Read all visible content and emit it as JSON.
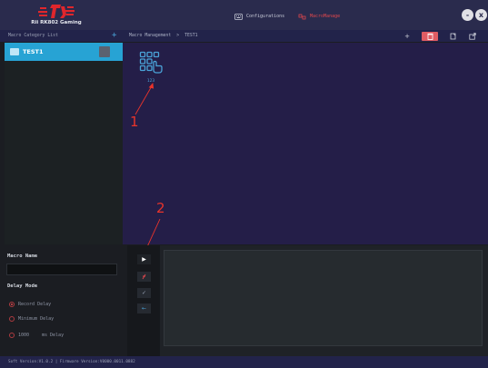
{
  "app": {
    "brand": "Rii RK802 Gaming",
    "nav": {
      "configurations": "Configurations",
      "macro_manage": "MacroManage"
    },
    "window": {
      "minimize": "-",
      "close": "x"
    }
  },
  "colors": {
    "header_bg": "#2a2b4d",
    "accent_blue": "#27a3d4",
    "accent_red": "#e0474d",
    "main_bg": "#241e48"
  },
  "category_panel": {
    "title": "Macro Category List",
    "add_icon": "plus-icon",
    "items": [
      {
        "label": "TEST1",
        "icon": "folder-icon",
        "selected": true
      }
    ]
  },
  "macro_panel": {
    "breadcrumb": {
      "root": "Macro Management",
      "separator": ">",
      "current": "TEST1"
    },
    "toolbar_icons": [
      "plus-icon",
      "delete-icon",
      "copy-icon",
      "export-icon"
    ],
    "macros": [
      {
        "label": "123",
        "icon": "keyboard-macro-icon"
      }
    ]
  },
  "annotations": [
    {
      "label": "1"
    },
    {
      "label": "2"
    }
  ],
  "editor": {
    "macro_name_label": "Macro Name",
    "macro_name_value": "",
    "delay_mode_label": "Delay Mode",
    "delay_options": [
      {
        "label": "Record Delay",
        "selected": true
      },
      {
        "label": "Minimum Delay",
        "selected": false
      },
      {
        "label": "ms Delay",
        "value": "1000",
        "selected": false
      }
    ],
    "actions": [
      "play-icon",
      "record-icon",
      "check-icon",
      "back-arrow-icon"
    ]
  },
  "status": {
    "text": "Soft Version:V1.0.2 | Firmware Version:V0000.0011.0882"
  }
}
